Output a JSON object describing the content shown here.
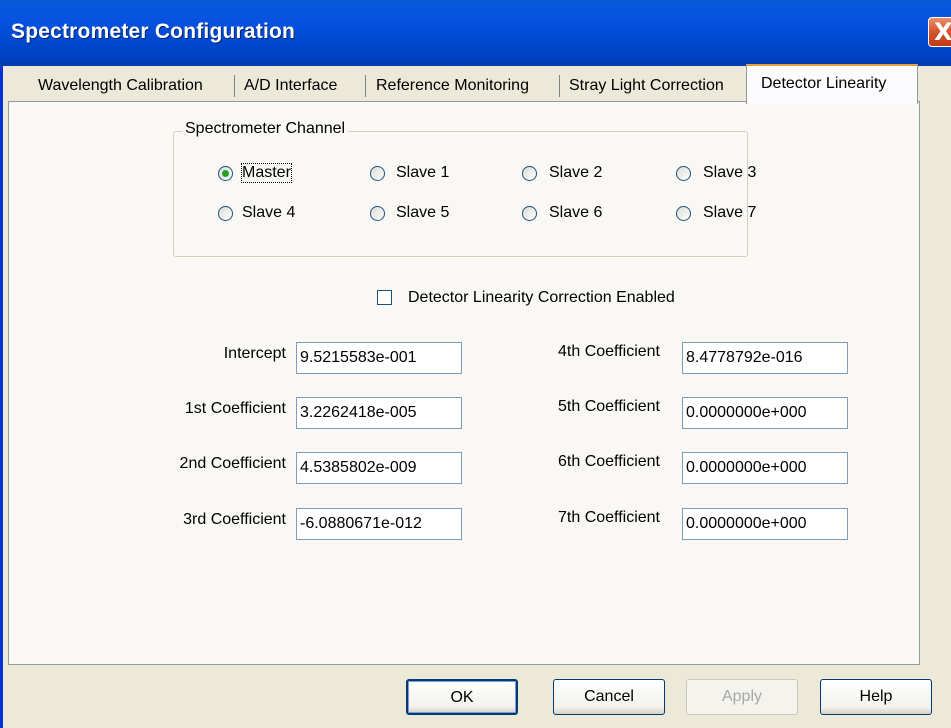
{
  "window": {
    "title": "Spectrometer Configuration"
  },
  "tabs": [
    {
      "label": "Wavelength Calibration",
      "active": false
    },
    {
      "label": "A/D Interface",
      "active": false
    },
    {
      "label": "Reference Monitoring",
      "active": false
    },
    {
      "label": "Stray Light Correction",
      "active": false
    },
    {
      "label": "Detector Linearity",
      "active": true
    }
  ],
  "channel_group": {
    "label": "Spectrometer Channel",
    "selected": "Master",
    "options": [
      "Master",
      "Slave 1",
      "Slave 2",
      "Slave 3",
      "Slave 4",
      "Slave 5",
      "Slave 6",
      "Slave 7"
    ]
  },
  "linearity_checkbox": {
    "label": "Detector Linearity Correction Enabled",
    "checked": false
  },
  "coefficients": [
    {
      "label": "Intercept",
      "value": "9.5215583e-001"
    },
    {
      "label": "1st Coefficient",
      "value": "3.2262418e-005"
    },
    {
      "label": "2nd Coefficient",
      "value": "4.5385802e-009"
    },
    {
      "label": "3rd Coefficient",
      "value": "-6.0880671e-012"
    },
    {
      "label": "4th Coefficient",
      "value": "8.4778792e-016"
    },
    {
      "label": "5th Coefficient",
      "value": "0.0000000e+000"
    },
    {
      "label": "6th Coefficient",
      "value": "0.0000000e+000"
    },
    {
      "label": "7th Coefficient",
      "value": "0.0000000e+000"
    }
  ],
  "buttons": {
    "ok": "OK",
    "cancel": "Cancel",
    "apply": "Apply",
    "help": "Help"
  },
  "close_glyph": "X"
}
